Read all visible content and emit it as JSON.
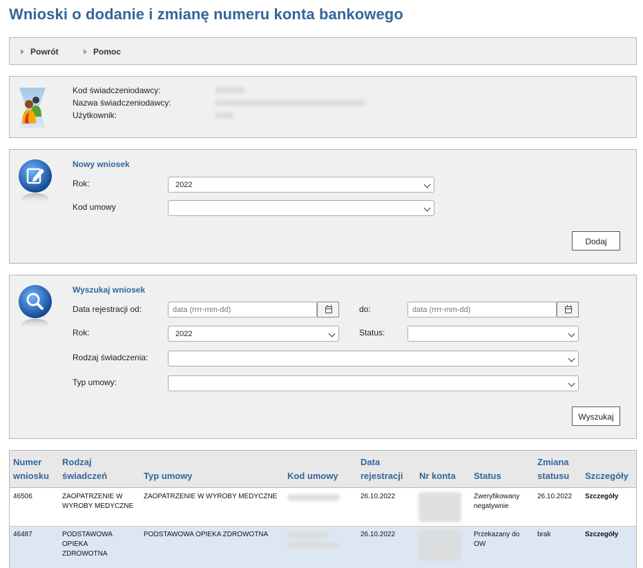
{
  "page": {
    "title": "Wnioski o dodanie i zmianę numeru konta bankowego"
  },
  "nav": {
    "back": "Powrót",
    "help": "Pomoc"
  },
  "provider": {
    "code_label": "Kod świadczeniodawcy:",
    "name_label": "Nazwa świadczeniodawcy:",
    "user_label": "Użytkownik:"
  },
  "new_request": {
    "title": "Nowy wniosek",
    "year_label": "Rok:",
    "year_value": "2022",
    "contract_label": "Kod umowy",
    "contract_value": "",
    "add_button": "Dodaj"
  },
  "search": {
    "title": "Wyszukaj wniosek",
    "date_from_label": "Data rejestracji od:",
    "date_from_placeholder": "data (rrrr-mm-dd)",
    "date_to_label": "do:",
    "date_to_placeholder": "data (rrrr-mm-dd)",
    "year_label": "Rok:",
    "year_value": "2022",
    "status_label": "Status:",
    "status_value": "",
    "benefit_label": "Rodzaj świadczenia:",
    "contract_type_label": "Typ umowy:",
    "search_button": "Wyszukaj"
  },
  "table": {
    "headers": {
      "number": [
        "Numer",
        "wniosku"
      ],
      "benefit": [
        "Rodzaj",
        "świadczeń"
      ],
      "contract_type": "Typ umowy",
      "contract_code": "Kod umowy",
      "reg_date": [
        "Data",
        "rejestracji"
      ],
      "account": "Nr konta",
      "status": "Status",
      "status_change": [
        "Zmiana",
        "statusu"
      ],
      "details": "Szczegóły"
    },
    "rows": [
      {
        "number": "46506",
        "benefit": [
          "ZAOPATRZENIE W",
          "WYROBY MEDYCZNE"
        ],
        "contract_type": "ZAOPATRZENIE W WYROBY MEDYCZNE",
        "reg_date": "26.10.2022",
        "status": [
          "Zweryfikowany",
          "negatywnie"
        ],
        "status_change": "26.10.2022",
        "details": "Szczegóły"
      },
      {
        "number": "46487",
        "benefit": [
          "PODSTAWOWA",
          "OPIEKA",
          "ZDROWOTNA"
        ],
        "contract_type": "PODSTAWOWA OPIEKA ZDROWOTNA",
        "reg_date": "26.10.2022",
        "status": [
          "Przekazany do",
          "OW"
        ],
        "status_change": "brak",
        "details": "Szczegóły"
      }
    ]
  },
  "colors": {
    "accent": "#336699",
    "panel_bg": "#f0f0f0",
    "row_alt": "#dde7f3"
  },
  "icons": {
    "provider": "users-icon",
    "new_request": "edit-icon",
    "search": "magnifier-icon"
  }
}
